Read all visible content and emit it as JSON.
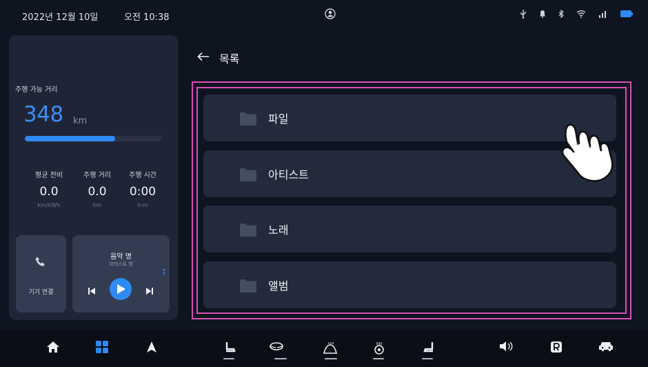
{
  "status_bar": {
    "date": "2022년 12월 10일",
    "time": "오전 10:38",
    "icons": [
      "user-icon",
      "usb-icon",
      "bell-icon",
      "bluetooth-icon",
      "wifi-icon",
      "signal-icon",
      "battery-icon"
    ]
  },
  "driving": {
    "range_label": "주행 가능 거리",
    "range_value": "348",
    "range_unit": "km",
    "range_fill_fraction": 0.66,
    "stats": [
      {
        "label": "평균 전비",
        "value": "0.0",
        "unit": "km/kWh"
      },
      {
        "label": "주행 거리",
        "value": "0.0",
        "unit": "km"
      },
      {
        "label": "주행 시간",
        "value": "0:00",
        "unit": "h:m"
      }
    ]
  },
  "phone": {
    "label": "기기 연결",
    "icon": "phone-icon"
  },
  "music": {
    "title": "음악 명",
    "artist": "아티스트 명"
  },
  "header": {
    "title": "목록",
    "back_icon": "back-arrow-icon"
  },
  "list": {
    "items": [
      {
        "label": "파일",
        "icon": "folder-icon"
      },
      {
        "label": "아티스트",
        "icon": "folder-icon"
      },
      {
        "label": "노래",
        "icon": "folder-icon"
      },
      {
        "label": "앨범",
        "icon": "folder-icon"
      }
    ]
  },
  "colors": {
    "accent": "#2f8af5",
    "highlight": "#d94fb6",
    "background": "#0f1421",
    "card": "#1f2536"
  },
  "dock": {
    "icons": [
      "home-icon",
      "apps-grid-icon",
      "navigation-icon",
      "seat-heat-icon",
      "steering-heat-icon",
      "rear-defrost-icon",
      "seat-vent-icon",
      "seat-adjust-icon",
      "volume-icon",
      "parking-icon",
      "car-icon"
    ]
  }
}
